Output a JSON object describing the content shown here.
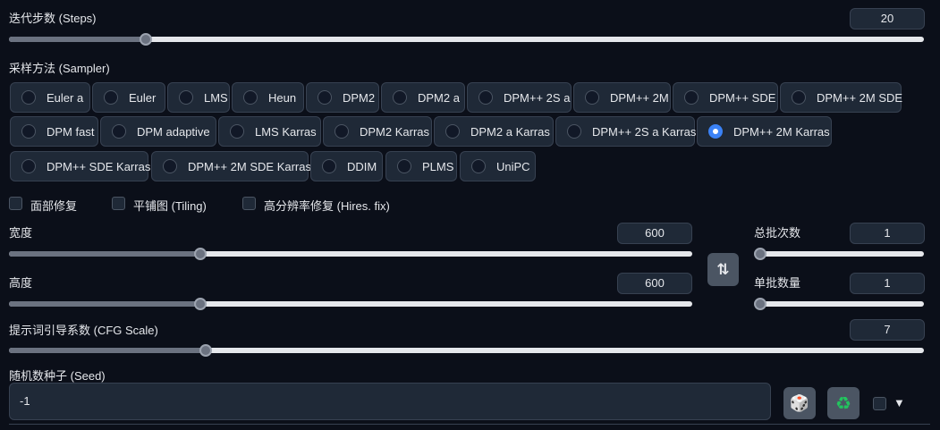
{
  "steps": {
    "label": "迭代步数 (Steps)",
    "value": "20",
    "level": 0.145
  },
  "sampler": {
    "label": "采样方法 (Sampler)",
    "selected": "DPM++ 2M Karras",
    "options": [
      "Euler a",
      "Euler",
      "LMS",
      "Heun",
      "DPM2",
      "DPM2 a",
      "DPM++ 2S a",
      "DPM++ 2M",
      "DPM++ SDE",
      "DPM++ 2M SDE",
      "DPM fast",
      "DPM adaptive",
      "LMS Karras",
      "DPM2 Karras",
      "DPM2 a Karras",
      "DPM++ 2S a Karras",
      "DPM++ 2M Karras",
      "DPM++ SDE Karras",
      "DPM++ 2M SDE Karras",
      "DDIM",
      "PLMS",
      "UniPC"
    ]
  },
  "checkboxes": {
    "face_restore": "面部修复",
    "tiling": "平铺图 (Tiling)",
    "hires_fix": "高分辨率修复 (Hires. fix)"
  },
  "width": {
    "label": "宽度",
    "value": "600",
    "level": 0.276
  },
  "height": {
    "label": "高度",
    "value": "600",
    "level": 0.276
  },
  "batch_count": {
    "label": "总批次数",
    "value": "1",
    "level": 0.0
  },
  "batch_size": {
    "label": "单批数量",
    "value": "1",
    "level": 0.0
  },
  "swap": {
    "icon": "swap-icon",
    "glyph": "⇅"
  },
  "cfg": {
    "label": "提示词引导系数 (CFG Scale)",
    "value": "7",
    "level": 0.211
  },
  "seed": {
    "label": "随机数种子 (Seed)",
    "value": "-1",
    "dice_icon": "🎲",
    "recycle_icon": "♻",
    "extra_arrow": "▼"
  },
  "colors": {
    "accent": "#3b82f6",
    "background": "#0b0f19",
    "panel": "#1f2937"
  }
}
